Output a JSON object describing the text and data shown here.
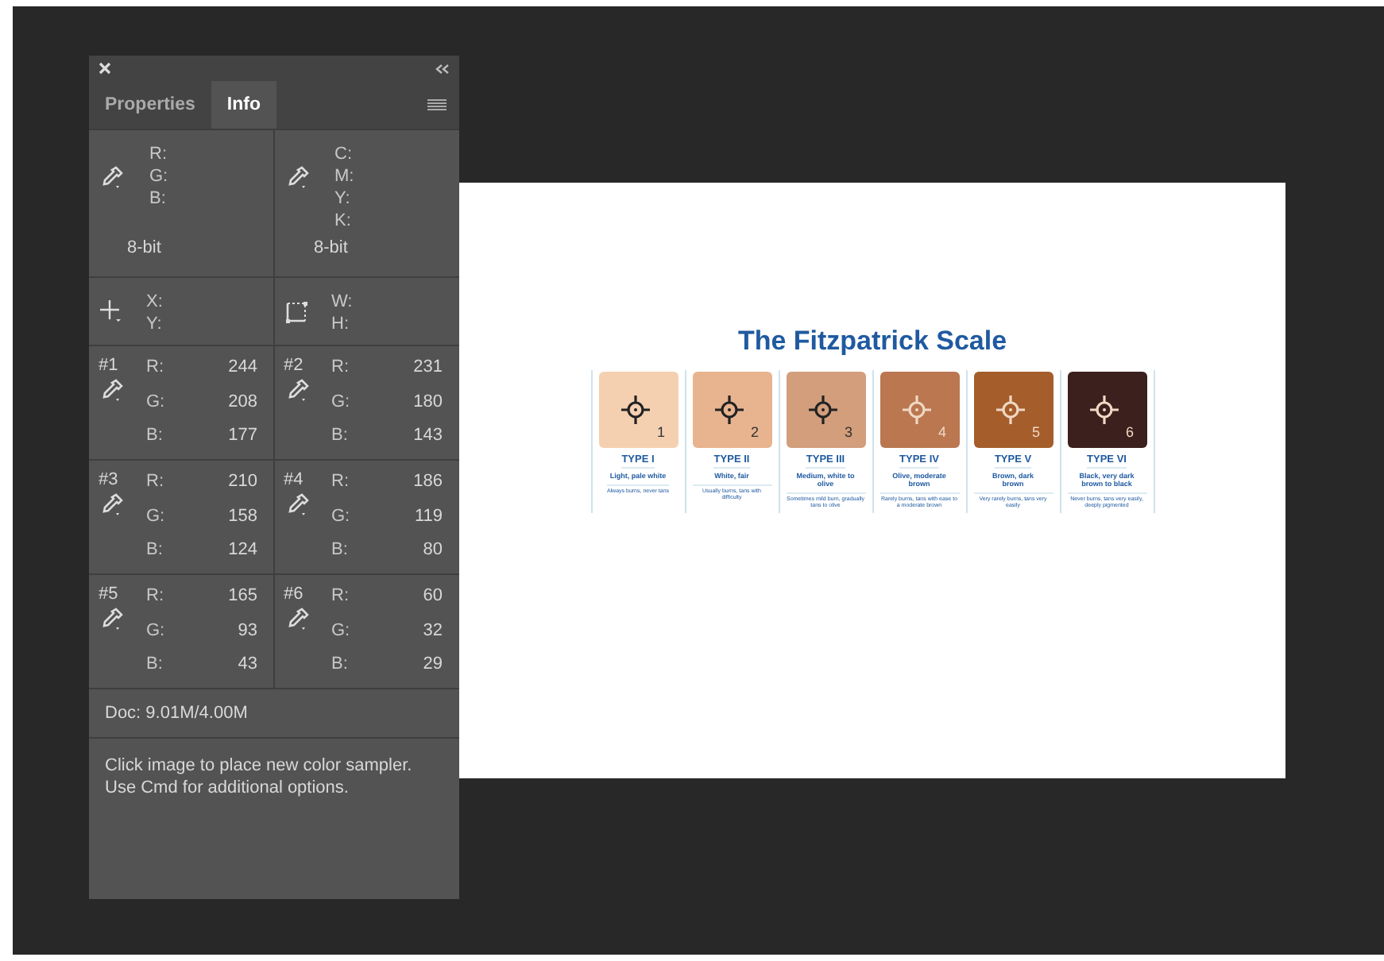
{
  "panel": {
    "tabs": [
      {
        "label": "Properties",
        "selected": false
      },
      {
        "label": "Info",
        "selected": true
      }
    ],
    "readouts": [
      {
        "kind": "rgb",
        "labels": [
          "R:",
          "G:",
          "B:"
        ],
        "mode": "8-bit"
      },
      {
        "kind": "cmyk",
        "labels": [
          "C:",
          "M:",
          "Y:",
          "K:"
        ],
        "mode": "8-bit"
      }
    ],
    "geometry": [
      {
        "kind": "position",
        "labels": [
          "X:",
          "Y:"
        ]
      },
      {
        "kind": "size",
        "labels": [
          "W:",
          "H:"
        ]
      }
    ],
    "samplers": [
      {
        "number": "#1",
        "channels": [
          {
            "label": "R:",
            "value": "244"
          },
          {
            "label": "G:",
            "value": "208"
          },
          {
            "label": "B:",
            "value": "177"
          }
        ]
      },
      {
        "number": "#2",
        "channels": [
          {
            "label": "R:",
            "value": "231"
          },
          {
            "label": "G:",
            "value": "180"
          },
          {
            "label": "B:",
            "value": "143"
          }
        ]
      },
      {
        "number": "#3",
        "channels": [
          {
            "label": "R:",
            "value": "210"
          },
          {
            "label": "G:",
            "value": "158"
          },
          {
            "label": "B:",
            "value": "124"
          }
        ]
      },
      {
        "number": "#4",
        "channels": [
          {
            "label": "R:",
            "value": "186"
          },
          {
            "label": "G:",
            "value": "119"
          },
          {
            "label": "B:",
            "value": "80"
          }
        ]
      },
      {
        "number": "#5",
        "channels": [
          {
            "label": "R:",
            "value": "165"
          },
          {
            "label": "G:",
            "value": "93"
          },
          {
            "label": "B:",
            "value": "43"
          }
        ]
      },
      {
        "number": "#6",
        "channels": [
          {
            "label": "R:",
            "value": "60"
          },
          {
            "label": "G:",
            "value": "32"
          },
          {
            "label": "B:",
            "value": "29"
          }
        ]
      }
    ],
    "doc": "Doc: 9.01M/4.00M",
    "hint": "Click image to place new color sampler. Use Cmd for additional options."
  },
  "document": {
    "title": "The Fitzpatrick Scale",
    "types": [
      {
        "marker": "1",
        "color": "#f4d0b1",
        "name": "TYPE I",
        "description": "Light, pale white",
        "note": "Always burns, never tans"
      },
      {
        "marker": "2",
        "color": "#e7b48f",
        "name": "TYPE II",
        "description": "White, fair",
        "note": "Usually burns, tans with difficulty"
      },
      {
        "marker": "3",
        "color": "#d29e7c",
        "name": "TYPE III",
        "description": "Medium, white to olive",
        "note": "Sometimes mild burn, gradually tans to olive"
      },
      {
        "marker": "4",
        "color": "#ba7750",
        "name": "TYPE IV",
        "description": "Olive, moderate brown",
        "note": "Rarely burns, tans with ease to a moderate brown"
      },
      {
        "marker": "5",
        "color": "#a55d2b",
        "name": "TYPE V",
        "description": "Brown, dark brown",
        "note": "Very rarely burns, tans very easily"
      },
      {
        "marker": "6",
        "color": "#3c201d",
        "name": "TYPE VI",
        "description": "Black, very dark brown to black",
        "note": "Never burns, tans very easily, deeply pigmented"
      }
    ]
  }
}
